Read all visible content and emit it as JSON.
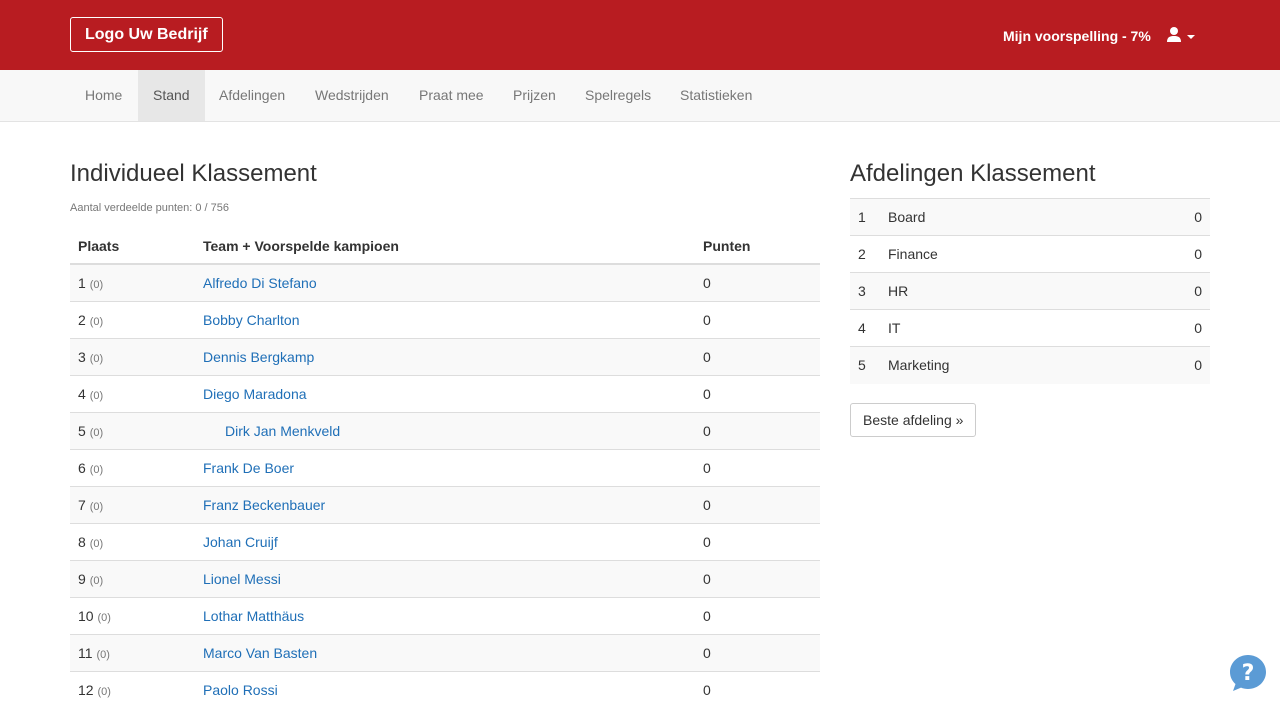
{
  "header": {
    "logo": "Logo Uw Bedrijf",
    "prediction": "Mijn voorspelling - 7%"
  },
  "nav": {
    "items": [
      "Home",
      "Stand",
      "Afdelingen",
      "Wedstrijden",
      "Praat mee",
      "Prijzen",
      "Spelregels",
      "Statistieken"
    ],
    "active": "Stand"
  },
  "individual": {
    "title": "Individueel Klassement",
    "info": "Aantal verdeelde punten: 0 / 756",
    "headers": {
      "rank": "Plaats",
      "team": "Team + Voorspelde kampioen",
      "points": "Punten"
    },
    "rows": [
      {
        "rank": "1",
        "prev": "(0)",
        "name": "Alfredo Di Stefano",
        "points": "0"
      },
      {
        "rank": "2",
        "prev": "(0)",
        "name": "Bobby Charlton",
        "points": "0"
      },
      {
        "rank": "3",
        "prev": "(0)",
        "name": "Dennis Bergkamp",
        "points": "0"
      },
      {
        "rank": "4",
        "prev": "(0)",
        "name": "Diego Maradona",
        "points": "0"
      },
      {
        "rank": "5",
        "prev": "(0)",
        "name": "Dirk Jan Menkveld",
        "points": "0"
      },
      {
        "rank": "6",
        "prev": "(0)",
        "name": "Frank De Boer",
        "points": "0"
      },
      {
        "rank": "7",
        "prev": "(0)",
        "name": "Franz Beckenbauer",
        "points": "0"
      },
      {
        "rank": "8",
        "prev": "(0)",
        "name": "Johan Cruijf",
        "points": "0"
      },
      {
        "rank": "9",
        "prev": "(0)",
        "name": "Lionel Messi",
        "points": "0"
      },
      {
        "rank": "10",
        "prev": "(0)",
        "name": "Lothar Matthäus",
        "points": "0"
      },
      {
        "rank": "11",
        "prev": "(0)",
        "name": "Marco Van Basten",
        "points": "0"
      },
      {
        "rank": "12",
        "prev": "(0)",
        "name": "Paolo Rossi",
        "points": "0"
      }
    ]
  },
  "departments": {
    "title": "Afdelingen Klassement",
    "rows": [
      {
        "rank": "1",
        "name": "Board",
        "points": "0"
      },
      {
        "rank": "2",
        "name": "Finance",
        "points": "0"
      },
      {
        "rank": "3",
        "name": "HR",
        "points": "0"
      },
      {
        "rank": "4",
        "name": "IT",
        "points": "0"
      },
      {
        "rank": "5",
        "name": "Marketing",
        "points": "0"
      }
    ],
    "button": "Beste afdeling »"
  },
  "colors": {
    "brand": "#b81c21",
    "link": "#1f6fb7"
  },
  "icons": {
    "user": "user-icon",
    "caret": "caret-down-icon",
    "help": "help-bubble-icon"
  }
}
